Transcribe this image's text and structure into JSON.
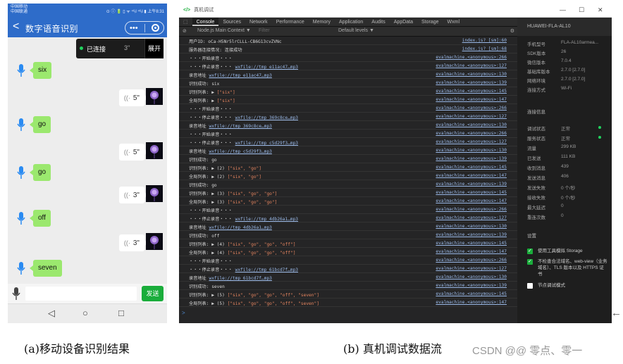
{
  "phone": {
    "status": {
      "carrier1": "中国移动",
      "carrier2": "中国联通",
      "right": "⊙ ⓘ 🔋 ▯ ᯤ ⁴⁶ᵢl ⁴⁶ᵢl ▮ 上午8:31"
    },
    "nav": {
      "back": "<",
      "title": "数字语音识别",
      "menu": "•••"
    },
    "connection": {
      "status": "已连接",
      "duration": "3\"",
      "button": "展开"
    },
    "messages": [
      {
        "side": "left",
        "text": "six"
      },
      {
        "side": "right",
        "duration": "5\""
      },
      {
        "side": "left",
        "text": "go"
      },
      {
        "side": "right",
        "duration": "5\""
      },
      {
        "side": "left",
        "text": "go"
      },
      {
        "side": "right",
        "duration": "3\""
      },
      {
        "side": "left",
        "text": "off"
      },
      {
        "side": "right",
        "duration": "3\""
      },
      {
        "side": "left",
        "text": "seven"
      }
    ],
    "input": {
      "placeholder": "",
      "send": "发送"
    },
    "navbar": {
      "back": "◁",
      "home": "○",
      "recent": "□"
    }
  },
  "devtools": {
    "window_title": "真机调试",
    "tabs": [
      "Console",
      "Sources",
      "Network",
      "Performance",
      "Memory",
      "Application",
      "Audits",
      "AppData",
      "Storage",
      "Wxml"
    ],
    "context": "Node.js Main Context ▼",
    "filter_placeholder": "Filter",
    "levels": "Default levels ▼",
    "lines": [
      {
        "msg": "用户ID: oCa-H5Nr5lrCLLL-CB6G13cvZVNc",
        "src": "index.js? [sm]:60"
      },
      {
        "msg": "服务器连接情况: 连接成功",
        "src": "index.js? [sm]:68"
      },
      {
        "msg": "・・・开始录音・・・",
        "src": "evalmachine.<anonymous>:266"
      },
      {
        "msg": "・・・停止录音・・・ ",
        "lnk": "wxfile://tmp_e11ac47…mp3",
        "src": "evalmachine.<anonymous>:127"
      },
      {
        "msg": "录音地址 ",
        "lnk": "wxfile://tmp_e11ac47…mp3",
        "src": "evalmachine.<anonymous>:130"
      },
      {
        "msg": "识别成功: six",
        "src": "evalmachine.<anonymous>:139"
      },
      {
        "msg": "识别列表: ▶ ",
        "str": "[\"six\"]",
        "src": "evalmachine.<anonymous>:145"
      },
      {
        "msg": "全局列表: ▶ ",
        "str": "[\"six\"]",
        "src": "evalmachine.<anonymous>:147"
      },
      {
        "msg": "・・・开始录音・・・",
        "src": "evalmachine.<anonymous>:266"
      },
      {
        "msg": "・・・停止录音・・・ ",
        "lnk": "wxfile://tmp_369c8ce…mp3",
        "src": "evalmachine.<anonymous>:127"
      },
      {
        "msg": "录音地址 ",
        "lnk": "wxfile://tmp_369c8ce…mp3",
        "src": "evalmachine.<anonymous>:130"
      },
      {
        "msg": "・・・开始录音・・・",
        "src": "evalmachine.<anonymous>:266"
      },
      {
        "msg": "・・・停止录音・・・ ",
        "lnk": "wxfile://tmp_c5d29f3…mp3",
        "src": "evalmachine.<anonymous>:127"
      },
      {
        "msg": "录音地址 ",
        "lnk": "wxfile://tmp_c5d29f3…mp3",
        "src": "evalmachine.<anonymous>:130"
      },
      {
        "msg": "识别成功: go",
        "src": "evalmachine.<anonymous>:139"
      },
      {
        "msg": "识别列表: ▶ (2) ",
        "str": "[\"six\", \"go\"]",
        "src": "evalmachine.<anonymous>:145"
      },
      {
        "msg": "全局列表: ▶ (2) ",
        "str": "[\"six\", \"go\"]",
        "src": "evalmachine.<anonymous>:147"
      },
      {
        "msg": "识别成功: go",
        "src": "evalmachine.<anonymous>:139"
      },
      {
        "msg": "识别列表: ▶ (3) ",
        "str": "[\"six\", \"go\", \"go\"]",
        "src": "evalmachine.<anonymous>:145"
      },
      {
        "msg": "全局列表: ▶ (3) ",
        "str": "[\"six\", \"go\", \"go\"]",
        "src": "evalmachine.<anonymous>:147"
      },
      {
        "msg": "・・・开始录音・・・",
        "src": "evalmachine.<anonymous>:266"
      },
      {
        "msg": "・・・停止录音・・・ ",
        "lnk": "wxfile://tmp_4db26a1…mp3",
        "src": "evalmachine.<anonymous>:127"
      },
      {
        "msg": "录音地址 ",
        "lnk": "wxfile://tmp_4db26a1…mp3",
        "src": "evalmachine.<anonymous>:130"
      },
      {
        "msg": "识别成功: off",
        "src": "evalmachine.<anonymous>:139"
      },
      {
        "msg": "识别列表: ▶ (4) ",
        "str": "[\"six\", \"go\", \"go\", \"off\"]",
        "src": "evalmachine.<anonymous>:145"
      },
      {
        "msg": "全局列表: ▶ (4) ",
        "str": "[\"six\", \"go\", \"go\", \"off\"]",
        "src": "evalmachine.<anonymous>:147"
      },
      {
        "msg": "・・・开始录音・・・",
        "src": "evalmachine.<anonymous>:266"
      },
      {
        "msg": "・・・停止录音・・・ ",
        "lnk": "wxfile://tmp_61bcd7f…mp3",
        "src": "evalmachine.<anonymous>:127"
      },
      {
        "msg": "录音地址 ",
        "lnk": "wxfile://tmp_61bcd7f…mp3",
        "src": "evalmachine.<anonymous>:130"
      },
      {
        "msg": "识别成功: seven",
        "src": "evalmachine.<anonymous>:139"
      },
      {
        "msg": "识别列表: ▶ (5) ",
        "str": "[\"six\", \"go\", \"go\", \"off\", \"seven\"]",
        "src": "evalmachine.<anonymous>:145"
      },
      {
        "msg": "全局列表: ▶ (5) ",
        "str": "[\"six\", \"go\", \"go\", \"off\", \"seven\"]",
        "src": "evalmachine.<anonymous>:147"
      }
    ],
    "prompt": ">"
  },
  "side": {
    "device": "HUAWEI-FLA-AL10",
    "info": [
      {
        "k": "手机型号",
        "v": "FLA-AL10armea..."
      },
      {
        "k": "SDK版本",
        "v": "26"
      },
      {
        "k": "微信版本",
        "v": "7.0.4"
      },
      {
        "k": "基础库版本",
        "v": "2.7.0 [2.7.0]"
      },
      {
        "k": "网络环境",
        "v": "2.7.0 [2.7.0]"
      },
      {
        "k": "连接方式",
        "v": "Wi-Fi"
      }
    ],
    "status_title": "连接信息",
    "status": [
      {
        "k": "调试状态",
        "v": "正常",
        "dot": true
      },
      {
        "k": "服务状态",
        "v": "正常",
        "dot": true
      },
      {
        "k": "流量",
        "v": "299 KB"
      },
      {
        "k": "已发送",
        "v": "111 KB"
      },
      {
        "k": "收到消息",
        "v": "439"
      },
      {
        "k": "发送消息",
        "v": "406"
      },
      {
        "k": "发送失败",
        "v": "0 个/秒"
      },
      {
        "k": "接收失败",
        "v": "0 个/秒"
      },
      {
        "k": "最大延迟",
        "v": "0"
      },
      {
        "k": "重连次数",
        "v": "0"
      }
    ],
    "settings_title": "设置",
    "checks": [
      {
        "label": "使用工具模拟 Storage",
        "on": true
      },
      {
        "label": "不检查合法域名、web-view（业务域名）、TLS 版本以及 HTTPS 证书",
        "on": true
      },
      {
        "label": "节点调试模式",
        "on": false
      }
    ],
    "controls": {
      "min": "—",
      "max": "☐",
      "close": "✕"
    }
  },
  "captions": {
    "a": "(a)移动设备识别结果",
    "b": "(b) 真机调试数据流"
  },
  "watermark": "CSDN @@ 零点、零一",
  "arrow": "←"
}
